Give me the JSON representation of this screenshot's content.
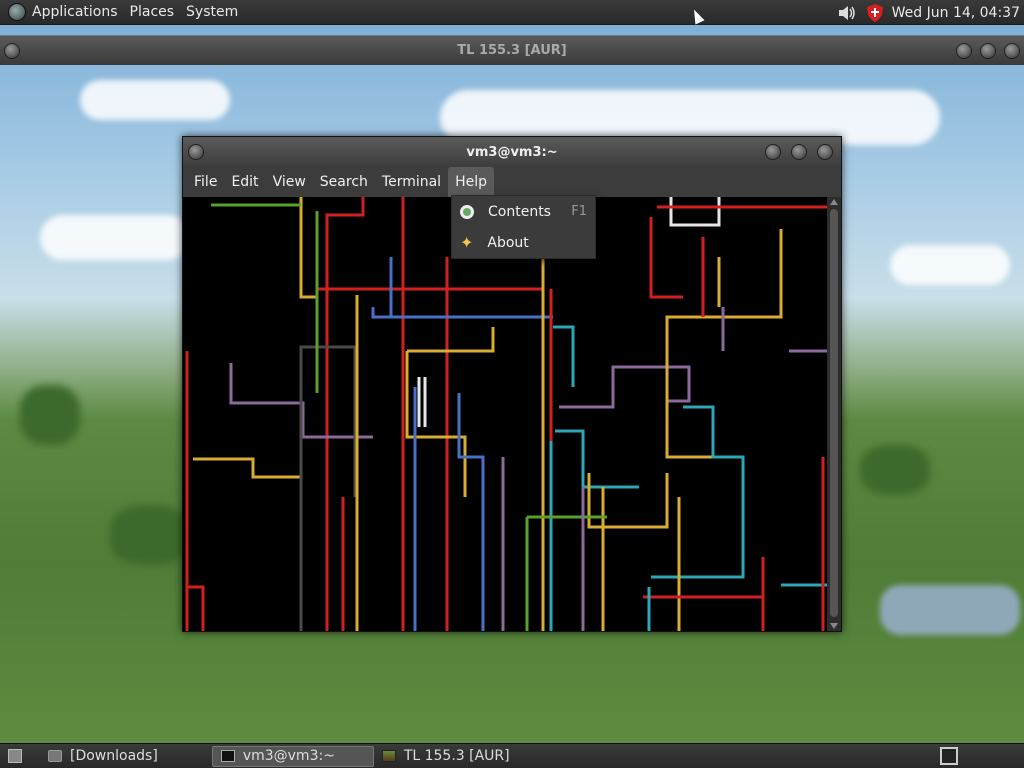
{
  "top_panel": {
    "menus": [
      "Applications",
      "Places",
      "System"
    ],
    "clock": "Wed Jun 14, 04:37"
  },
  "back_window": {
    "title": "TL 155.3 [AUR]"
  },
  "terminal": {
    "title": "vm3@vm3:~",
    "menus": [
      "File",
      "Edit",
      "View",
      "Search",
      "Terminal",
      "Help"
    ],
    "active_menu": "Help"
  },
  "help_menu": {
    "items": [
      {
        "label": "Contents",
        "accel": "F1",
        "icon": "lifebuoy-icon"
      },
      {
        "label": "About",
        "accel": "",
        "icon": "star-icon"
      }
    ]
  },
  "taskbar": {
    "tasks": [
      {
        "label": "[Downloads]",
        "icon": "folder-icon",
        "active": false
      },
      {
        "label": "vm3@vm3:~",
        "icon": "terminal-icon",
        "active": true
      },
      {
        "label": "TL 155.3 [AUR]",
        "icon": "cube-icon",
        "active": false
      }
    ]
  },
  "colors": {
    "red": "#d21f1f",
    "yellow": "#d9ac32",
    "green": "#5aa02e",
    "blue": "#4a6fc7",
    "cyan": "#2aa8b8",
    "purple": "#8a6a9a",
    "grey": "#4a4a4a",
    "white": "#e6e6e6"
  }
}
